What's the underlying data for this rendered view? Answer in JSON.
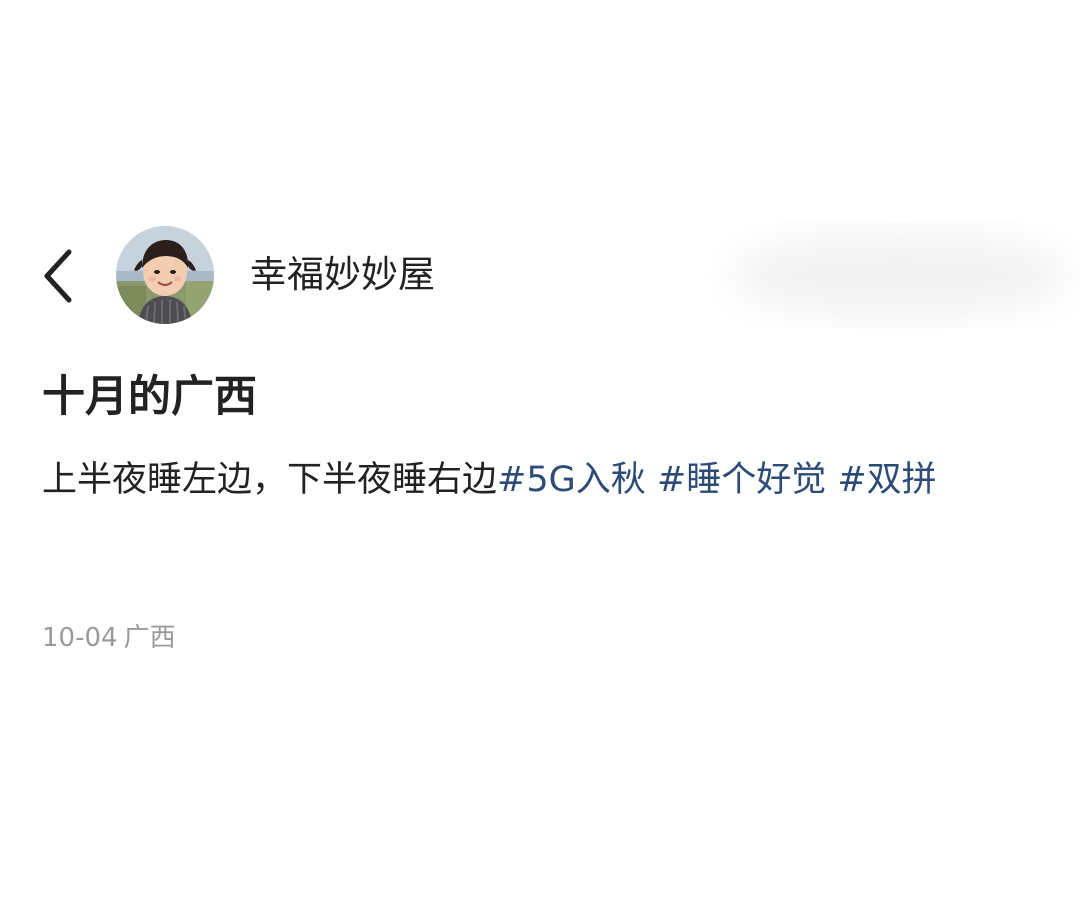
{
  "header": {
    "author_name": "幸福妙妙屋"
  },
  "icons": {
    "back": "chevron-left-icon",
    "avatar": "child-portrait-avatar"
  },
  "post": {
    "title": "十月的广西",
    "body_text": "上半夜睡左边，下半夜睡右边",
    "hashtags": [
      {
        "label": "#5G入秋"
      },
      {
        "label": "#睡个好觉"
      },
      {
        "label": "#双拼"
      }
    ],
    "date": "10-04",
    "location": "广西"
  },
  "colors": {
    "text_primary": "#222222",
    "hashtag": "#2c4b77",
    "meta": "#9a9a9a",
    "background": "#ffffff"
  }
}
